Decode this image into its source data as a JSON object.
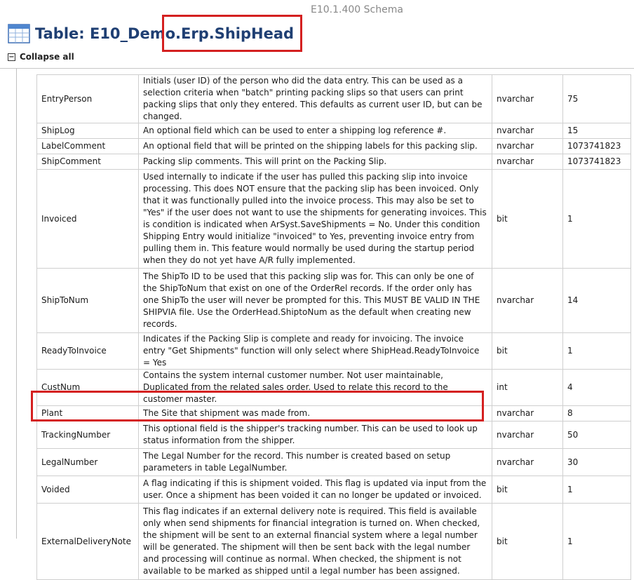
{
  "header": {
    "schema_version": "E10.1.400 Schema",
    "title": "Table: E10_Demo.Erp.ShipHead",
    "collapse_all": "Collapse all",
    "collapse_symbol": "−"
  },
  "colors": {
    "title": "#1f3f73",
    "highlight": "#d42020",
    "grid_border": "#cfcfcf"
  },
  "rows": [
    {
      "name": "EntryPerson",
      "description": "Initials (user ID) of the person who did the data entry. This can be used as a selection criteria when \"batch\" printing packing slips so that users can print packing slips that only they entered. This defaults as current user ID, but can be changed.",
      "type": "nvarchar",
      "length": "75"
    },
    {
      "name": "ShipLog",
      "description": "An optional field which can be used to enter a shipping log reference #.",
      "type": "nvarchar",
      "length": "15"
    },
    {
      "name": "LabelComment",
      "description": "An optional field that will be printed on the shipping labels for this packing slip.",
      "type": "nvarchar",
      "length": "1073741823"
    },
    {
      "name": "ShipComment",
      "description": "Packing slip comments. This will print on the Packing Slip.",
      "type": "nvarchar",
      "length": "1073741823"
    },
    {
      "name": "Invoiced",
      "description": "Used internally to indicate if the user has pulled this packing slip into invoice processing. This does NOT ensure that the packing slip has been invoiced. Only that it was functionally pulled into the invoice process. This may also be set to \"Yes\" if the user does not want to use the shipments for generating invoices. This is condition is indicated when ArSyst.SaveShipments = No. Under this condition Shipping Entry would initialize \"invoiced\" to Yes, preventing invoice entry from pulling them in. This feature would normally be used during the startup period when they do not yet have A/R fully implemented.",
      "type": "bit",
      "length": "1"
    },
    {
      "name": "ShipToNum",
      "description": "The ShipTo ID to be used that this packing slip was for. This can only be one of the ShipToNum that exist on one of the OrderRel records. If the order only has one ShipTo the user will never be prompted for this. This MUST BE VALID IN THE SHIPVIA file. Use the OrderHead.ShiptoNum as the default when creating new records.",
      "type": "nvarchar",
      "length": "14"
    },
    {
      "name": "ReadyToInvoice",
      "description": "Indicates if the Packing Slip is complete and ready for invoicing. The invoice entry \"Get Shipments\" function will only select where ShipHead.ReadyToInvoice = Yes",
      "type": "bit",
      "length": "1"
    },
    {
      "name": "CustNum",
      "description": "Contains the system internal customer number. Not user maintainable, Duplicated from the related sales order. Used to relate this record to the customer master.",
      "type": "int",
      "length": "4"
    },
    {
      "name": "Plant",
      "description": "The Site that shipment was made from.",
      "type": "nvarchar",
      "length": "8"
    },
    {
      "name": "TrackingNumber",
      "description": "This optional field is the shipper's tracking number. This can be used to look up status information from the shipper.",
      "type": "nvarchar",
      "length": "50"
    },
    {
      "name": "LegalNumber",
      "description": "The Legal Number for the record. This number is created based on setup parameters in table LegalNumber.",
      "type": "nvarchar",
      "length": "30"
    },
    {
      "name": "Voided",
      "description": "A flag indicating if this is shipment voided. This flag is updated via input from the user. Once a shipment has been voided it can no longer be updated or invoiced.",
      "type": "bit",
      "length": "1"
    },
    {
      "name": "ExternalDeliveryNote",
      "description": "This flag indicates if an external delivery note is required. This field is available only when send shipments for financial integration is turned on. When checked, the shipment will be sent to an external financial system where a legal number will be generated. The shipment will then be sent back with the legal number and processing will continue as normal. When checked, the shipment is not available to be marked as shipped until a legal number has been assigned.",
      "type": "bit",
      "length": "1"
    }
  ]
}
